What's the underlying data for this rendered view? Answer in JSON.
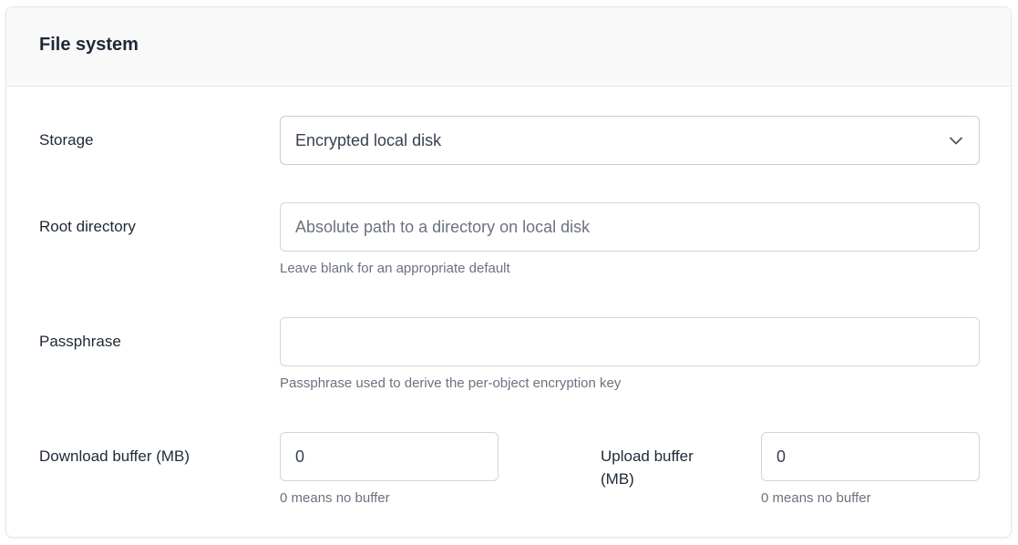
{
  "card": {
    "title": "File system"
  },
  "storage": {
    "label": "Storage",
    "selected": "Encrypted local disk",
    "icon": "chevron-down-icon"
  },
  "root_directory": {
    "label": "Root directory",
    "value": "",
    "placeholder": "Absolute path to a directory on local disk",
    "help": "Leave blank for an appropriate default"
  },
  "passphrase": {
    "label": "Passphrase",
    "value": "",
    "help": "Passphrase used to derive the per-object encryption key"
  },
  "download_buffer": {
    "label": "Download buffer (MB)",
    "value": "0",
    "help": "0 means no buffer"
  },
  "upload_buffer": {
    "label_line1": "Upload buffer",
    "label_line2": "(MB)",
    "value": "0",
    "help": "0 means no buffer"
  },
  "colors": {
    "header_bg": "#f9f9fa",
    "border": "#d1d5db",
    "text": "#1f2937",
    "muted": "#6b7280"
  }
}
